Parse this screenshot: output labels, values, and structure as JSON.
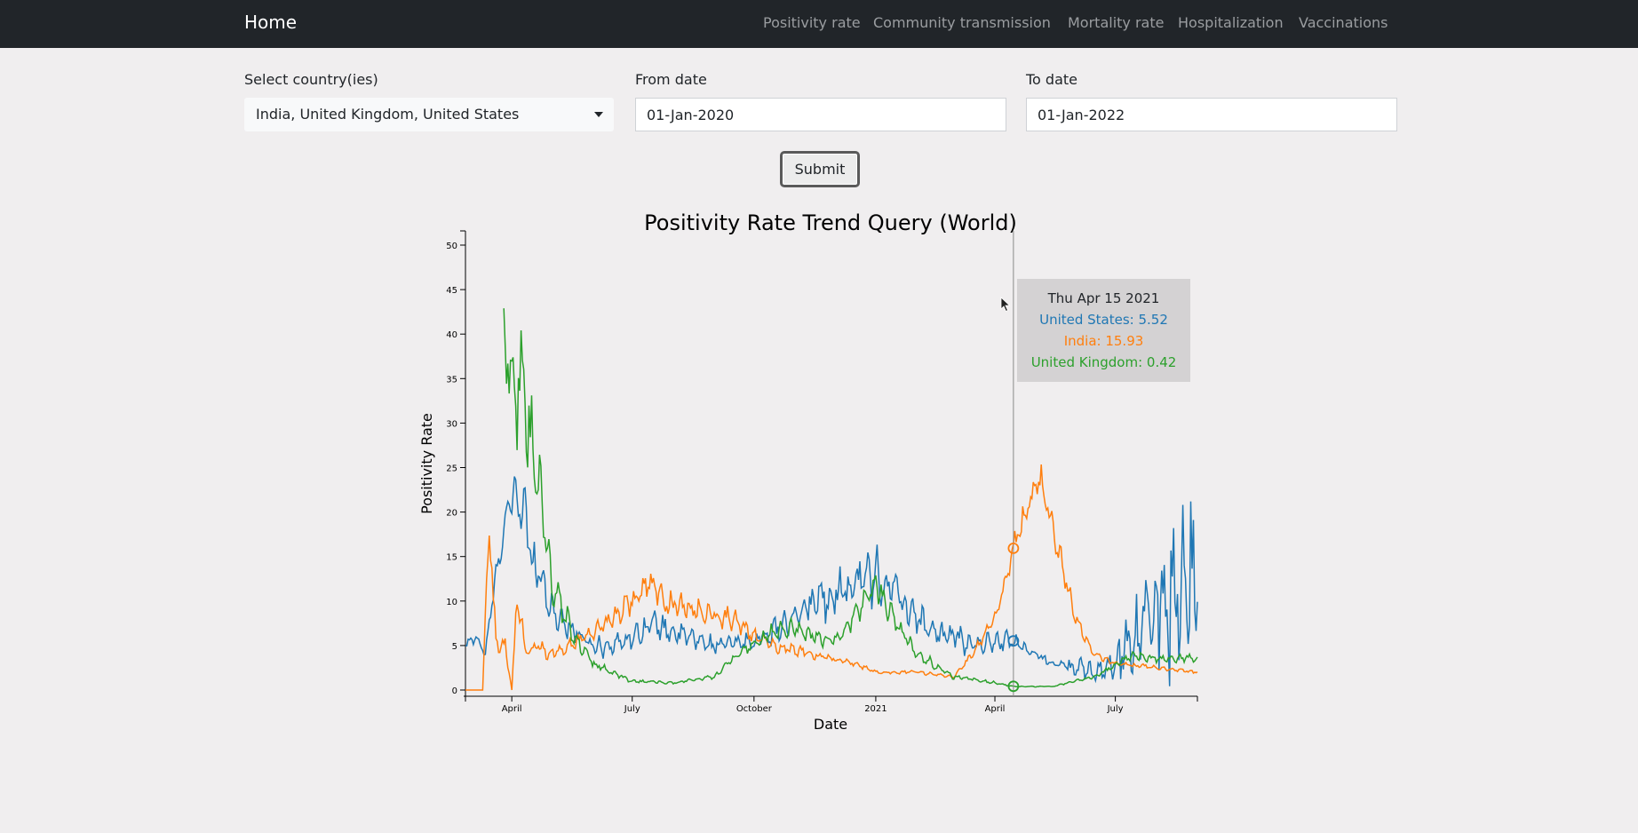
{
  "navbar": {
    "brand": "Home",
    "links": [
      "Positivity rate",
      "Community transmission",
      "Mortality rate",
      "Hospitalization",
      "Vaccinations"
    ]
  },
  "form": {
    "country_label": "Select country(ies)",
    "country_value": "India, United Kingdom, United States",
    "from_label": "From date",
    "from_value": "01-Jan-2020",
    "to_label": "To date",
    "to_value": "01-Jan-2022",
    "submit_label": "Submit"
  },
  "tooltip": {
    "date": "Thu Apr 15 2021",
    "lines": [
      "United States: 5.52",
      "India: 15.93",
      "United Kingdom: 0.42"
    ]
  },
  "chart_data": {
    "type": "line",
    "title": "Positivity Rate Trend Query (World)",
    "xlabel": "Date",
    "ylabel": "Positivity Rate",
    "x_range": [
      "2020-02-26",
      "2021-09-01"
    ],
    "ylim": [
      0,
      50
    ],
    "y_ticks": [
      0,
      5,
      10,
      15,
      20,
      25,
      30,
      35,
      40,
      45,
      50
    ],
    "x_ticks": [
      {
        "label": "April",
        "date": "2020-04-01"
      },
      {
        "label": "July",
        "date": "2020-07-01"
      },
      {
        "label": "October",
        "date": "2020-10-01"
      },
      {
        "label": "2021",
        "date": "2021-01-01"
      },
      {
        "label": "April",
        "date": "2021-04-01"
      },
      {
        "label": "July",
        "date": "2021-07-01"
      }
    ],
    "hover_date": "2021-04-15",
    "series": [
      {
        "name": "United States",
        "color": "#1f77b4",
        "amplitude": [
          0.1,
          0.2,
          0.25,
          0.2,
          0.2,
          0.2,
          0.2,
          0.25,
          0.25,
          0.25,
          0.2,
          0.15,
          0.5,
          0.8,
          0.9
        ],
        "points": [
          [
            "2020-02-26",
            5
          ],
          [
            "2020-03-05",
            6
          ],
          [
            "2020-03-12",
            4
          ],
          [
            "2020-03-19",
            12
          ],
          [
            "2020-03-26",
            18
          ],
          [
            "2020-04-02",
            22
          ],
          [
            "2020-04-09",
            21
          ],
          [
            "2020-04-16",
            15
          ],
          [
            "2020-04-23",
            13
          ],
          [
            "2020-05-01",
            9
          ],
          [
            "2020-05-15",
            7
          ],
          [
            "2020-06-01",
            5
          ],
          [
            "2020-06-15",
            5
          ],
          [
            "2020-07-01",
            6
          ],
          [
            "2020-07-15",
            7.5
          ],
          [
            "2020-08-01",
            6.5
          ],
          [
            "2020-09-01",
            5
          ],
          [
            "2020-10-01",
            5.5
          ],
          [
            "2020-10-15",
            6.5
          ],
          [
            "2020-11-01",
            8
          ],
          [
            "2020-11-15",
            10
          ],
          [
            "2020-12-01",
            11
          ],
          [
            "2020-12-15",
            12
          ],
          [
            "2021-01-01",
            13
          ],
          [
            "2021-01-15",
            11
          ],
          [
            "2021-02-01",
            8
          ],
          [
            "2021-02-15",
            6.5
          ],
          [
            "2021-03-01",
            6
          ],
          [
            "2021-03-15",
            5
          ],
          [
            "2021-04-01",
            5.5
          ],
          [
            "2021-04-15",
            5.5
          ],
          [
            "2021-05-01",
            4
          ],
          [
            "2021-05-15",
            3
          ],
          [
            "2021-06-01",
            2.5
          ],
          [
            "2021-06-15",
            2
          ],
          [
            "2021-07-01",
            3
          ],
          [
            "2021-07-15",
            6
          ],
          [
            "2021-08-01",
            9
          ],
          [
            "2021-08-15",
            11
          ],
          [
            "2021-09-01",
            13
          ]
        ]
      },
      {
        "name": "India",
        "color": "#ff7f0e",
        "amplitude": [
          0.2,
          0.2,
          0.15,
          0.15,
          0.15,
          0.15,
          0.15,
          0.1,
          0.1,
          0.1,
          0.1,
          0.1,
          0.1,
          0.1,
          0.1
        ],
        "points": [
          [
            "2020-02-26",
            0
          ],
          [
            "2020-03-10",
            0
          ],
          [
            "2020-03-15",
            20
          ],
          [
            "2020-03-20",
            5
          ],
          [
            "2020-03-27",
            5
          ],
          [
            "2020-04-01",
            0
          ],
          [
            "2020-04-05",
            10
          ],
          [
            "2020-04-12",
            4
          ],
          [
            "2020-04-20",
            5
          ],
          [
            "2020-05-01",
            4
          ],
          [
            "2020-05-15",
            5
          ],
          [
            "2020-06-01",
            6.5
          ],
          [
            "2020-06-15",
            8
          ],
          [
            "2020-07-01",
            10
          ],
          [
            "2020-07-15",
            12
          ],
          [
            "2020-07-25",
            10
          ],
          [
            "2020-08-15",
            9
          ],
          [
            "2020-09-01",
            8.5
          ],
          [
            "2020-09-15",
            8
          ],
          [
            "2020-10-01",
            6
          ],
          [
            "2020-10-15",
            5
          ],
          [
            "2020-11-01",
            4.5
          ],
          [
            "2020-11-15",
            4
          ],
          [
            "2020-12-01",
            3.5
          ],
          [
            "2020-12-15",
            3
          ],
          [
            "2021-01-01",
            2
          ],
          [
            "2021-02-01",
            2
          ],
          [
            "2021-03-01",
            1.5
          ],
          [
            "2021-03-15",
            4
          ],
          [
            "2021-04-01",
            8
          ],
          [
            "2021-04-15",
            16
          ],
          [
            "2021-04-25",
            20
          ],
          [
            "2021-05-05",
            24
          ],
          [
            "2021-05-15",
            18
          ],
          [
            "2021-06-01",
            8
          ],
          [
            "2021-06-15",
            4
          ],
          [
            "2021-07-01",
            3
          ],
          [
            "2021-08-01",
            2.5
          ],
          [
            "2021-09-01",
            2
          ]
        ]
      },
      {
        "name": "United Kingdom",
        "color": "#2ca02c",
        "amplitude": [
          0.15,
          0.2,
          0.2,
          0.2,
          0.15,
          0.15,
          0.15,
          0.15,
          0.15,
          0.2,
          0.2,
          0.15,
          0.15,
          0.15,
          0.15
        ],
        "points": [
          [
            "2020-03-26",
            40
          ],
          [
            "2020-04-01",
            36
          ],
          [
            "2020-04-08",
            33
          ],
          [
            "2020-04-15",
            28
          ],
          [
            "2020-04-22",
            22
          ],
          [
            "2020-05-01",
            12
          ],
          [
            "2020-05-15",
            7
          ],
          [
            "2020-06-01",
            3
          ],
          [
            "2020-06-15",
            2
          ],
          [
            "2020-07-01",
            1
          ],
          [
            "2020-08-01",
            0.8
          ],
          [
            "2020-09-01",
            1.5
          ],
          [
            "2020-09-15",
            3.5
          ],
          [
            "2020-10-01",
            5
          ],
          [
            "2020-10-15",
            6.5
          ],
          [
            "2020-11-01",
            7
          ],
          [
            "2020-11-15",
            6
          ],
          [
            "2020-12-01",
            5.5
          ],
          [
            "2020-12-15",
            8
          ],
          [
            "2021-01-01",
            12
          ],
          [
            "2021-01-15",
            8
          ],
          [
            "2021-02-01",
            4
          ],
          [
            "2021-03-01",
            1.5
          ],
          [
            "2021-04-01",
            0.8
          ],
          [
            "2021-04-15",
            0.4
          ],
          [
            "2021-05-15",
            0.4
          ],
          [
            "2021-06-15",
            1.5
          ],
          [
            "2021-07-15",
            4
          ],
          [
            "2021-08-01",
            3.5
          ],
          [
            "2021-09-01",
            3.5
          ]
        ]
      }
    ],
    "hover_points": [
      {
        "series": "United States",
        "value": 5.52
      },
      {
        "series": "India",
        "value": 15.93
      },
      {
        "series": "United Kingdom",
        "value": 0.42
      }
    ]
  }
}
